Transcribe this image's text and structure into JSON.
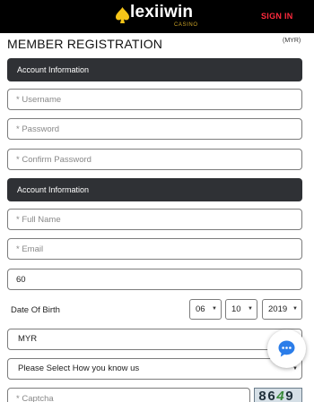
{
  "header": {
    "logo_text": "lexiiwin",
    "logo_subtext": "CASINO",
    "signin_label": "SIGN IN"
  },
  "page": {
    "title": "MEMBER REGISTRATION",
    "currency_note": "(MYR)"
  },
  "sections": {
    "account_1": "Account Information",
    "account_2": "Account Information"
  },
  "fields": {
    "username_placeholder": "* Username",
    "password_placeholder": "* Password",
    "confirm_password_placeholder": "* Confirm Password",
    "full_name_placeholder": "* Full Name",
    "email_placeholder": "* Email",
    "phone_prefix": "60",
    "dob_label": "Date Of Birth",
    "dob_month": "06",
    "dob_day": "10",
    "dob_year": "2019",
    "currency": "MYR",
    "referral_select": "Please Select How you know us",
    "captcha_placeholder": "* Captcha"
  },
  "captcha": {
    "code_part1": "86",
    "code_part2": "4",
    "code_part3": "9"
  },
  "colors": {
    "topbar": "#000000",
    "signin": "#ff2a3d",
    "section_header": "#2f3135",
    "chat_icon": "#2b7de9",
    "logo_spade": "#f5c518"
  }
}
